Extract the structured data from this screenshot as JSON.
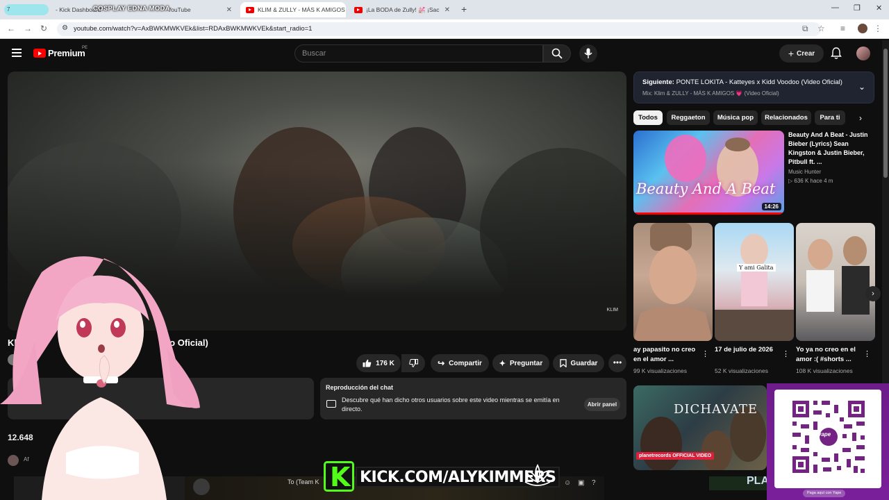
{
  "browser": {
    "tabs": [
      {
        "title": "- Kick Dashboard",
        "active": false
      },
      {
        "title": "YouTube",
        "active": false
      },
      {
        "title": "KLIM & ZULLY - MÁS K AMIGOS",
        "active": true
      },
      {
        "title": "¡La BODA de Zully! 💒 ¡Sac",
        "active": false
      }
    ],
    "url": "youtube.com/watch?v=AxBWKMWKVEk&list=RDAxBWKMWKVEk&start_radio=1",
    "counter": "7"
  },
  "youtube": {
    "brand": "Premium",
    "region": "PE",
    "search_placeholder": "Buscar",
    "create_label": "Crear"
  },
  "video": {
    "title_fragment_left": "Klim &",
    "title_fragment_right": "deo Oficial)",
    "watermark": "KLIM",
    "likes": "176 K",
    "share": "Compartir",
    "ask": "Preguntar",
    "save": "Guardar",
    "views_fragment": "12.648",
    "comment_name_fragment": "Af"
  },
  "chat_replay": {
    "title": "Reproducción del chat",
    "text": "Descubre qué han dicho otros usuarios sobre este video mientras se emitía en directo.",
    "button": "Abrir panel"
  },
  "up_next": {
    "label": "Siguiente:",
    "title": "PONTE LOKITA - Katteyes x Kidd Voodoo (Video Oficial)",
    "mix": "Mix: Klim & ZULLY - MÁS K AMIGOS 💗 (Video Oficial)"
  },
  "chips": [
    "Todos",
    "Reggaeton",
    "Música pop",
    "Relacionados",
    "Para ti"
  ],
  "recommended": {
    "title": "Beauty And A Beat - Justin Bieber (Lyrics) Sean Kingston & Justin Bieber, Pitbull ft. ...",
    "channel": "Music Hunter",
    "stats": "▷ 636 K  hace 4 m",
    "thumb_text": "Beauty And A Beat",
    "duration": "14:26"
  },
  "shorts": [
    {
      "title": "ay papasito no creo en el amor ...",
      "views": "99 K visualizaciones"
    },
    {
      "title": "17 de julio de 2026",
      "views": "52 K visualizaciones",
      "caption": "Y ami Galita"
    },
    {
      "title": "Yo ya no creo en el amor :( #shorts ...",
      "views": "108 K visualizaciones"
    }
  ],
  "rec2": {
    "thumb_title": "DICHAVATE",
    "badge": "planetrecords OFFICIAL VIDEO"
  },
  "overlays": {
    "banner": "COSPLAY EDNA MODA",
    "kick_url": "KICK.COM/ALYKIMMERS",
    "kick_letter": "K",
    "qr_caption": "Paga aquí con Yape",
    "qr_logo": "yape",
    "game_text": "To (Team K",
    "right_text": "PLA"
  },
  "colors": {
    "yt_red": "#ff0000",
    "kick_green": "#53fc18",
    "yape_purple": "#742284"
  }
}
